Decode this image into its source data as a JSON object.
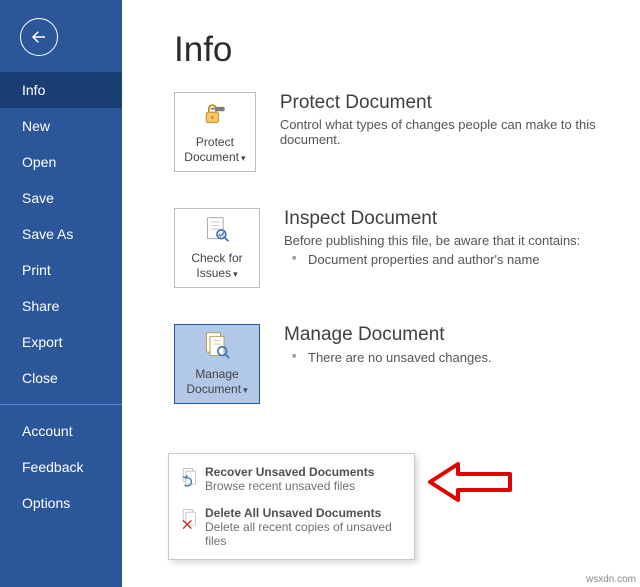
{
  "sidebar": {
    "items": [
      {
        "label": "Info",
        "selected": true
      },
      {
        "label": "New"
      },
      {
        "label": "Open"
      },
      {
        "label": "Save"
      },
      {
        "label": "Save As"
      },
      {
        "label": "Print"
      },
      {
        "label": "Share"
      },
      {
        "label": "Export"
      },
      {
        "label": "Close"
      }
    ],
    "footer": [
      {
        "label": "Account"
      },
      {
        "label": "Feedback"
      },
      {
        "label": "Options"
      }
    ]
  },
  "page": {
    "title": "Info"
  },
  "sections": {
    "protect": {
      "tile_line1": "Protect",
      "tile_line2": "Document",
      "heading": "Protect Document",
      "body": "Control what types of changes people can make to this document."
    },
    "inspect": {
      "tile_line1": "Check for",
      "tile_line2": "Issues",
      "heading": "Inspect Document",
      "body": "Before publishing this file, be aware that it contains:",
      "bullet": "Document properties and author's name"
    },
    "manage": {
      "tile_line1": "Manage",
      "tile_line2": "Document",
      "heading": "Manage Document",
      "body": "There are no unsaved changes."
    }
  },
  "dropdown": {
    "recover": {
      "title": "Recover Unsaved Documents",
      "sub": "Browse recent unsaved files"
    },
    "delete": {
      "title": "Delete All Unsaved Documents",
      "sub": "Delete all recent copies of unsaved files"
    }
  },
  "watermark": "wsxdn.com"
}
